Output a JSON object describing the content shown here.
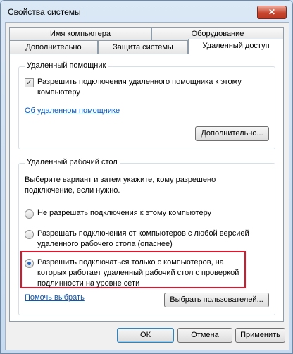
{
  "window": {
    "title": "Свойства системы",
    "close_glyph": "✕"
  },
  "tabs": {
    "row1": [
      "Имя компьютера",
      "Оборудование"
    ],
    "row2": [
      "Дополнительно",
      "Защита системы",
      "Удаленный доступ"
    ]
  },
  "assistance": {
    "title": "Удаленный помощник",
    "checkbox_label": "Разрешить подключения удаленного помощника к этому компьютеру",
    "checkbox_checked": true,
    "link": "Об удаленном помощнике",
    "advanced_button": "Дополнительно..."
  },
  "desktop": {
    "title": "Удаленный рабочий стол",
    "instruction": "Выберите вариант и затем укажите, кому разрешено подключение, если нужно.",
    "options": [
      "Не разрешать подключения к этому компьютеру",
      "Разрешать подключения от компьютеров с любой версией удаленного рабочего стола (опаснее)",
      "Разрешить подключаться только с компьютеров, на которых работает удаленный рабочий стол с проверкой подлинности на уровне сети"
    ],
    "selected_option": 2,
    "help_link": "Помочь выбрать",
    "select_users_button": "Выбрать пользователей..."
  },
  "footer": {
    "ok": "ОК",
    "cancel": "Отмена",
    "apply": "Применить"
  },
  "colors": {
    "highlight": "#e0142a",
    "link": "#0b57b7"
  }
}
